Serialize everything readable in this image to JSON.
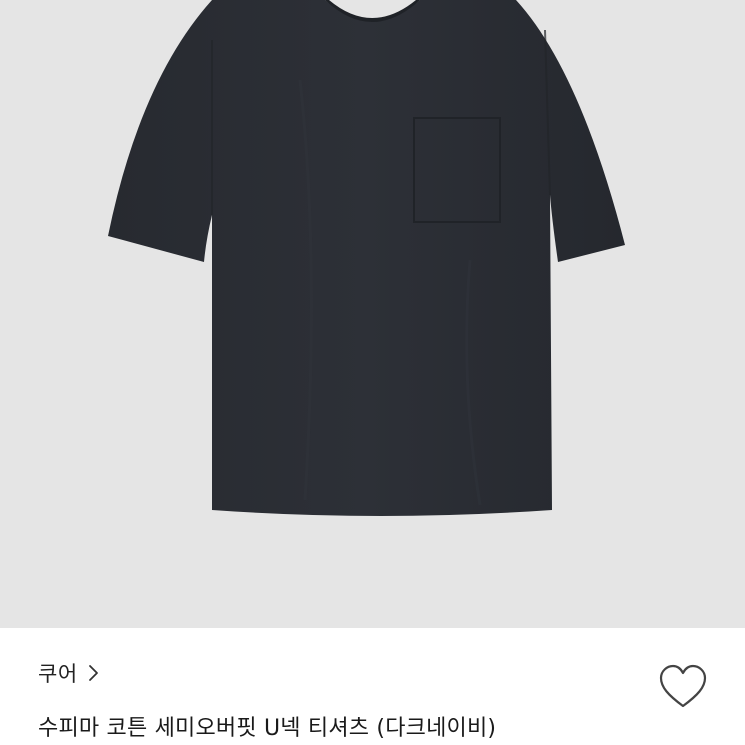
{
  "product": {
    "brand": "쿠어",
    "title": "수피마 코튼 세미오버핏 U넥 티셔츠 (다크네이비)",
    "image": {
      "background_color": "#e5e5e5",
      "garment_color": "#2a2d33"
    }
  },
  "icons": {
    "brand_chevron": "chevron-right-icon",
    "like": "heart-outline-icon"
  }
}
